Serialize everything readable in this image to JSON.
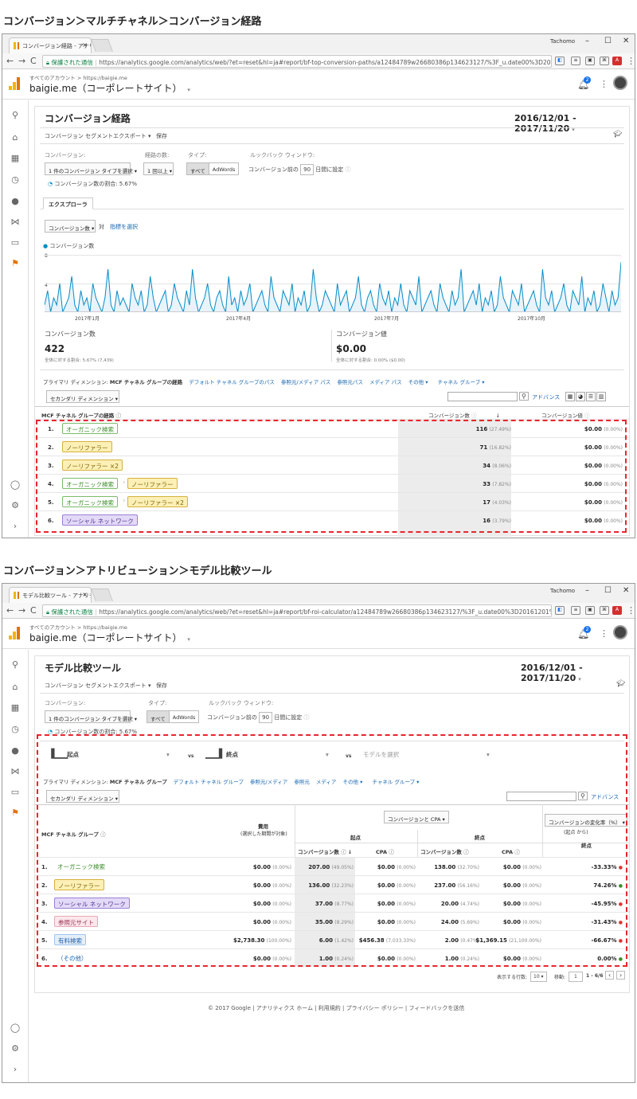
{
  "section1_title": "コンバージョン＞マルチチャネル＞コンバージョン経路",
  "section2_title": "コンバージョン＞アトリビューション＞モデル比較ツール",
  "browser": {
    "user_name": "Tachomo",
    "minimize": "–",
    "maximize": "☐",
    "close": "✕",
    "secure_label": "保護された通信",
    "back": "←",
    "forward": "→",
    "reload": "C"
  },
  "window1": {
    "tab_label": "コンバージョン経路 - アナリテ",
    "url": "https://analytics.google.com/analytics/web/?et=reset&hl=ja#report/bf-top-conversion-paths/a12484789w26680386p134623127/%3F_u.date00%3D20161201%2..."
  },
  "window2": {
    "tab_label": "モデル比較ツール - アナリテ",
    "url": "https://analytics.google.com/analytics/web/?et=reset&hl=ja#report/bf-roi-calculator/a12484789w26680386p134623127/%3F_u.date00%3D20161201%26_u.date..."
  },
  "header": {
    "all_accounts": "すべてのアカウント > https://baigie.me",
    "property": "baigie.me（コーポレートサイト）",
    "property_caret": "▾",
    "badge": "2"
  },
  "report1": {
    "title": "コンバージョン経路",
    "date_range": "2016/12/01 - 2017/11/20",
    "toolbar": {
      "segment": "コンバージョン セグメント",
      "export": "エクスポート ▾",
      "save": "保存"
    },
    "conversion_label": "コンバージョン:",
    "conversion_select": "1 件のコンバージョン タイプを選択",
    "path_length_label": "経路の数:",
    "path_length_select": "1 回以上",
    "type_label": "タイプ:",
    "type_all": "すべて",
    "type_adwords": "AdWords",
    "lookback_label": "ルックバック ウィンドウ:",
    "lookback_prefix": "コンバージョン前の",
    "lookback_days": "90",
    "lookback_suffix": "日間に設定",
    "ratio": "コンバージョン数の割合: 5.67%",
    "explorer_tab": "エクスプローラ",
    "metric_select": "コンバージョン数",
    "vs": "対",
    "choose_metric": "指標を選択",
    "legend": "コンバージョン数",
    "metrics": [
      {
        "label": "コンバージョン数",
        "value": "422",
        "sub": "全体に対する割合: 5.67% (7,439)"
      },
      {
        "label": "コンバージョン値",
        "value": "$0.00",
        "sub": "全体に対する割合: 0.00% ($0.00)"
      }
    ],
    "primary_dim_label": "プライマリ ディメンション:",
    "primary_dim_active": "MCF チャネル グループの経路",
    "primary_dims": [
      "デフォルト チャネル グループのパス",
      "参照元/メディア パス",
      "参照元パス",
      "メディア パス",
      "その他 ▾",
      "チャネル グループ ▾"
    ],
    "secondary_dim": "セカンダリ ディメンション",
    "advanced": "アドバンス",
    "col_path": "MCF チャネル グループの経路",
    "col_conv": "コンバージョン数",
    "col_value": "コンバージョン値",
    "rows": [
      {
        "n": "1.",
        "chips": [
          {
            "t": "オーガニック検索",
            "c": "green"
          }
        ],
        "conv": "116",
        "conv_pct": "(27.49%)",
        "val": "$0.00",
        "val_pct": "(0.00%)"
      },
      {
        "n": "2.",
        "chips": [
          {
            "t": "ノーリファラー",
            "c": "yellow"
          }
        ],
        "conv": "71",
        "conv_pct": "(16.82%)",
        "val": "$0.00",
        "val_pct": "(0.00%)"
      },
      {
        "n": "3.",
        "chips": [
          {
            "t": "ノーリファラー ×2",
            "c": "yellow"
          }
        ],
        "conv": "34",
        "conv_pct": "(8.06%)",
        "val": "$0.00",
        "val_pct": "(0.00%)"
      },
      {
        "n": "4.",
        "chips": [
          {
            "t": "オーガニック検索",
            "c": "green"
          },
          {
            "t": "ノーリファラー",
            "c": "yellow"
          }
        ],
        "conv": "33",
        "conv_pct": "(7.82%)",
        "val": "$0.00",
        "val_pct": "(0.00%)"
      },
      {
        "n": "5.",
        "chips": [
          {
            "t": "オーガニック検索",
            "c": "green"
          },
          {
            "t": "ノーリファラー ×2",
            "c": "yellow"
          }
        ],
        "conv": "17",
        "conv_pct": "(4.03%)",
        "val": "$0.00",
        "val_pct": "(0.00%)"
      },
      {
        "n": "6.",
        "chips": [
          {
            "t": "ソーシャル ネットワーク",
            "c": "purple"
          }
        ],
        "conv": "16",
        "conv_pct": "(3.79%)",
        "val": "$0.00",
        "val_pct": "(0.00%)"
      }
    ]
  },
  "chart_data": {
    "type": "line",
    "title": "",
    "series": [
      {
        "name": "コンバージョン数",
        "values": [
          1,
          3,
          0,
          2,
          1,
          4,
          0,
          1,
          2,
          5,
          1,
          0,
          3,
          1,
          2,
          0,
          4,
          2,
          1,
          0,
          2,
          6,
          1,
          0,
          3,
          1,
          2,
          1,
          0,
          4,
          2,
          1,
          3,
          0,
          1,
          5,
          2,
          0,
          1,
          2,
          3,
          0,
          1,
          4,
          2,
          1,
          0,
          3,
          1,
          6,
          2,
          0,
          1,
          2,
          4,
          1,
          0,
          2,
          3,
          1,
          0,
          5,
          1,
          2,
          0,
          3,
          1,
          2,
          4,
          0,
          1,
          2,
          3,
          1,
          0,
          5,
          2,
          1,
          0,
          3,
          2,
          1,
          4,
          0,
          2,
          1,
          3,
          0,
          1,
          6,
          2,
          0,
          1,
          3,
          2,
          1,
          0,
          4,
          1,
          2,
          3,
          0,
          1,
          2,
          5,
          1,
          0,
          2,
          3,
          1,
          0,
          4,
          2,
          1,
          3,
          0,
          2,
          1,
          4,
          1,
          0,
          3,
          2,
          1,
          5,
          0,
          1,
          2,
          3,
          1,
          0,
          4,
          2,
          1,
          0,
          3,
          1,
          2,
          6,
          0,
          1,
          2,
          3,
          1,
          4,
          0,
          2,
          1,
          3,
          0,
          1,
          5,
          2,
          1,
          0,
          3,
          2,
          1,
          4,
          0,
          1,
          2,
          3,
          1,
          0,
          6,
          2,
          1,
          3,
          0,
          1,
          2,
          4,
          1,
          0,
          3,
          2,
          1,
          5,
          0,
          2,
          1,
          3,
          0,
          1,
          4,
          2,
          0,
          3,
          1,
          2,
          7
        ]
      }
    ],
    "x_ticks": [
      "2017年1月",
      "2017年4月",
      "2017年7月",
      "2017年10月"
    ],
    "y_ticks": [
      "8",
      "4"
    ],
    "ylim": [
      0,
      8
    ],
    "color": "#058dc7"
  },
  "report2": {
    "title": "モデル比較ツール",
    "date_range": "2016/12/01 - 2017/11/20",
    "toolbar": {
      "segment": "コンバージョン セグメント",
      "export": "エクスポート ▾",
      "save": "保存"
    },
    "conversion_label": "コンバージョン:",
    "conversion_select": "1 件のコンバージョン タイプを選択",
    "type_label": "タイプ:",
    "type_all": "すべて",
    "type_adwords": "AdWords",
    "lookback_label": "ルックバック ウィンドウ:",
    "lookback_prefix": "コンバージョン前の",
    "lookback_days": "90",
    "lookback_suffix": "日間に設定",
    "ratio": "コンバージョン数の割合: 5.67%",
    "model1": "起点",
    "vs": "vs",
    "model2": "終点",
    "model3_placeholder": "モデルを選択",
    "primary_dim_label": "プライマリ ディメンション:",
    "primary_dim_active": "MCF チャネル グループ",
    "primary_dims": [
      "デフォルト チャネル グループ",
      "参照元/メディア",
      "参照元",
      "メディア",
      "その他 ▾",
      "チャネル グループ ▾"
    ],
    "secondary_dim": "セカンダリ ディメンション",
    "advanced": "アドバンス",
    "metric_select": "コンバージョンと CPA",
    "change_select": "コンバージョンの変化率（%）",
    "change_sub": "(起点 から)",
    "col_group": "MCF チャネル グループ",
    "col_cost": "費用",
    "col_cost_sub": "(選択した期間が対象)",
    "col_first": "起点",
    "col_last": "終点",
    "col_conv": "コンバージョン数",
    "col_cpa": "CPA",
    "col_change": "終点",
    "rows": [
      {
        "n": "1.",
        "chip": "オーガニック検索",
        "c": "plain-green",
        "cost": "$0.00",
        "cost_pct": "(0.00%)",
        "c1": "207.00",
        "c1p": "(49.05%)",
        "cpa1": "$0.00",
        "cpa1p": "(0.00%)",
        "c2": "138.00",
        "c2p": "(32.70%)",
        "cpa2": "$0.00",
        "cpa2p": "(0.00%)",
        "chg": "-33.33%"
      },
      {
        "n": "2.",
        "chip": "ノーリファラー",
        "c": "yellow",
        "cost": "$0.00",
        "cost_pct": "(0.00%)",
        "c1": "136.00",
        "c1p": "(32.23%)",
        "cpa1": "$0.00",
        "cpa1p": "(0.00%)",
        "c2": "237.00",
        "c2p": "(56.16%)",
        "cpa2": "$0.00",
        "cpa2p": "(0.00%)",
        "chg": "74.26%"
      },
      {
        "n": "3.",
        "chip": "ソーシャル ネットワーク",
        "c": "purple",
        "cost": "$0.00",
        "cost_pct": "(0.00%)",
        "c1": "37.00",
        "c1p": "(8.77%)",
        "cpa1": "$0.00",
        "cpa1p": "(0.00%)",
        "c2": "20.00",
        "c2p": "(4.74%)",
        "cpa2": "$0.00",
        "cpa2p": "(0.00%)",
        "chg": "-45.95%"
      },
      {
        "n": "4.",
        "chip": "参照元サイト",
        "c": "pink",
        "cost": "$0.00",
        "cost_pct": "(0.00%)",
        "c1": "35.00",
        "c1p": "(8.29%)",
        "cpa1": "$0.00",
        "cpa1p": "(0.00%)",
        "c2": "24.00",
        "c2p": "(5.69%)",
        "cpa2": "$0.00",
        "cpa2p": "(0.00%)",
        "chg": "-31.43%"
      },
      {
        "n": "5.",
        "chip": "有料検索",
        "c": "blue",
        "cost": "$2,738.30",
        "cost_pct": "(100.00%)",
        "c1": "6.00",
        "c1p": "(1.42%)",
        "cpa1": "$456.38",
        "cpa1p": "(7,033.33%)",
        "c2": "2.00",
        "c2p": "(0.47%)",
        "cpa2": "$1,369.15",
        "cpa2p": "(21,100.00%)",
        "chg": "-66.67%"
      },
      {
        "n": "6.",
        "chip": "（その他）",
        "c": "plain",
        "cost": "$0.00",
        "cost_pct": "(0.00%)",
        "c1": "1.00",
        "c1p": "(0.24%)",
        "cpa1": "$0.00",
        "cpa1p": "(0.00%)",
        "c2": "1.00",
        "c2p": "(0.24%)",
        "cpa2": "$0.00",
        "cpa2p": "(0.00%)",
        "chg": "0.00%"
      }
    ],
    "pager_label": "表示する行数:",
    "pager_rows": "10",
    "goto_label": "移動:",
    "goto_value": "1",
    "range": "1 - 6/6",
    "footer": "© 2017 Google | アナリティクス ホーム | 利用規約 | プライバシー ポリシー | フィードバックを送信"
  },
  "colors": {
    "accent": "#e37400",
    "link": "#1a67b1",
    "line": "#058dc7",
    "dashed": "#e8262e"
  }
}
